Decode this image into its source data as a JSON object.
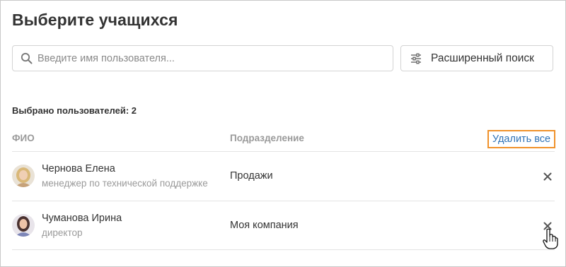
{
  "page": {
    "title": "Выберите учащихся"
  },
  "search": {
    "placeholder": "Введите имя пользователя...",
    "value": ""
  },
  "advanced_search": {
    "label": "Расширенный поиск"
  },
  "selection": {
    "count_label": "Выбрано пользователей: 2"
  },
  "table": {
    "headers": {
      "name": "ФИО",
      "department": "Подразделение"
    },
    "delete_all_label": "Удалить все",
    "rows": [
      {
        "name": "Чернова Елена",
        "position": "менеджер по технической поддержке",
        "department": "Продажи",
        "avatar": "avatar-photo-woman-blonde"
      },
      {
        "name": "Чуманова Ирина",
        "position": "директор",
        "department": "Моя компания",
        "avatar": "avatar-photo-woman-dark-hair"
      }
    ]
  },
  "icons": {
    "search": "search-icon",
    "filter": "sliders-icon",
    "remove": "close-icon",
    "cursor": "hand-pointer-cursor"
  },
  "colors": {
    "accent_link": "#2f73b7",
    "highlight_border": "#f0922b",
    "muted_text": "#9a9a9a"
  }
}
